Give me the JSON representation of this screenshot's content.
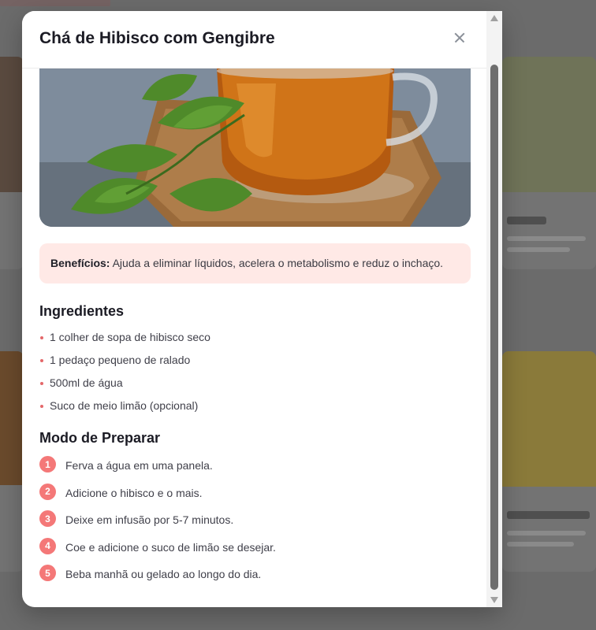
{
  "modal": {
    "title": "Chá de Hibisco com Gengibre",
    "close_label": "×"
  },
  "benefits": {
    "label": "Benefícios:",
    "text": " Ajuda a eliminar líquidos, acelera o metabolismo e reduz o inchaço."
  },
  "ingredients": {
    "heading": "Ingredientes",
    "items": [
      "1 colher de sopa de hibisco seco",
      "1 pedaço pequeno de ralado",
      "500ml de água",
      "Suco de meio limão (opcional)"
    ]
  },
  "preparation": {
    "heading": "Modo de Preparar",
    "steps": [
      {
        "number": "1",
        "text": "Ferva a água em uma panela."
      },
      {
        "number": "2",
        "text": "Adicione o hibisco e o mais."
      },
      {
        "number": "3",
        "text": "Deixe em infusão por 5-7 minutos."
      },
      {
        "number": "4",
        "text": "Coe e adicione o suco de limão se desejar."
      },
      {
        "number": "5",
        "text": "Beba manhã ou gelado ao longo do dia."
      }
    ]
  },
  "colors": {
    "accent": "#f47878",
    "benefits_bg": "#ffe9e6",
    "overlay": "#6b6b6b"
  },
  "icons": {
    "close": "close-icon",
    "scroll_up": "arrow-up-icon",
    "scroll_down": "arrow-down-icon"
  }
}
